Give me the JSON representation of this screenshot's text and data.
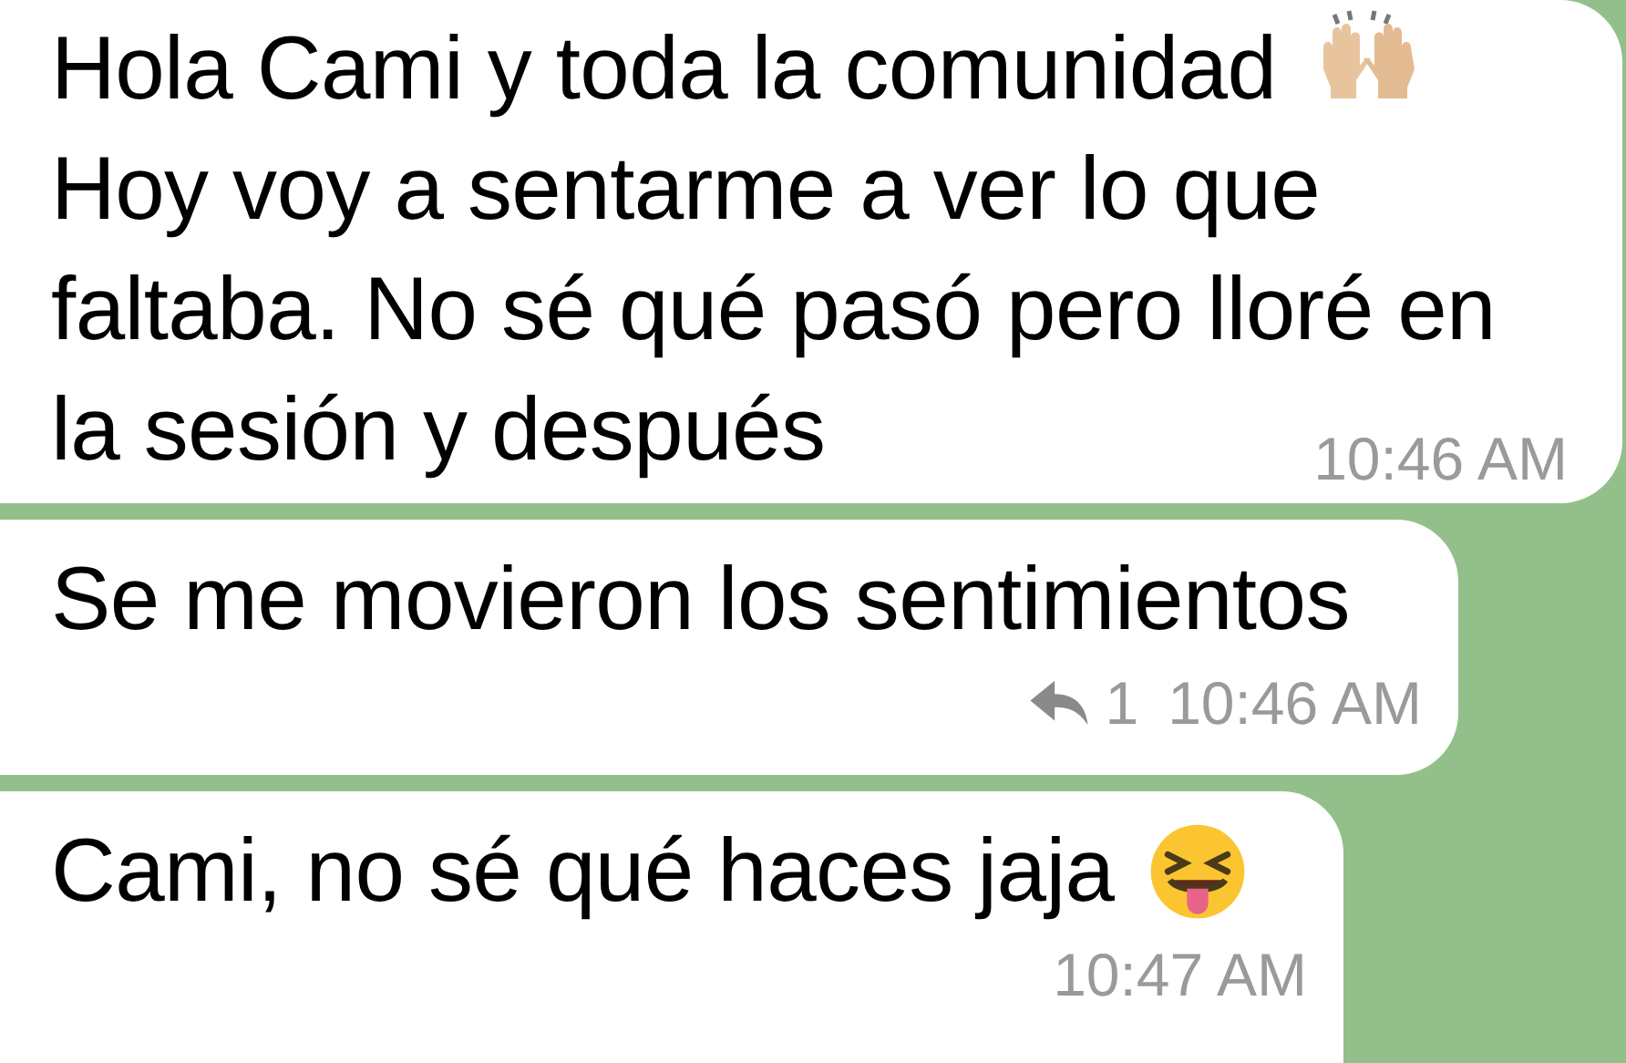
{
  "messages": [
    {
      "lines": [
        "Hola Cami y toda la comunidad",
        "Hoy voy a sentarme a ver lo que",
        "faltaba. No sé qué pasó pero lloré en",
        "la sesión y después"
      ],
      "kind": "raised_hands",
      "time": "10:46 AM"
    },
    {
      "lines": [
        "Se me movieron los sentimientos"
      ],
      "replies": "1",
      "time": "10:46 AM"
    },
    {
      "lines": [
        "Cami, no sé qué haces jaja"
      ],
      "kind": "squint_tongue",
      "time": "10:47 AM"
    }
  ]
}
